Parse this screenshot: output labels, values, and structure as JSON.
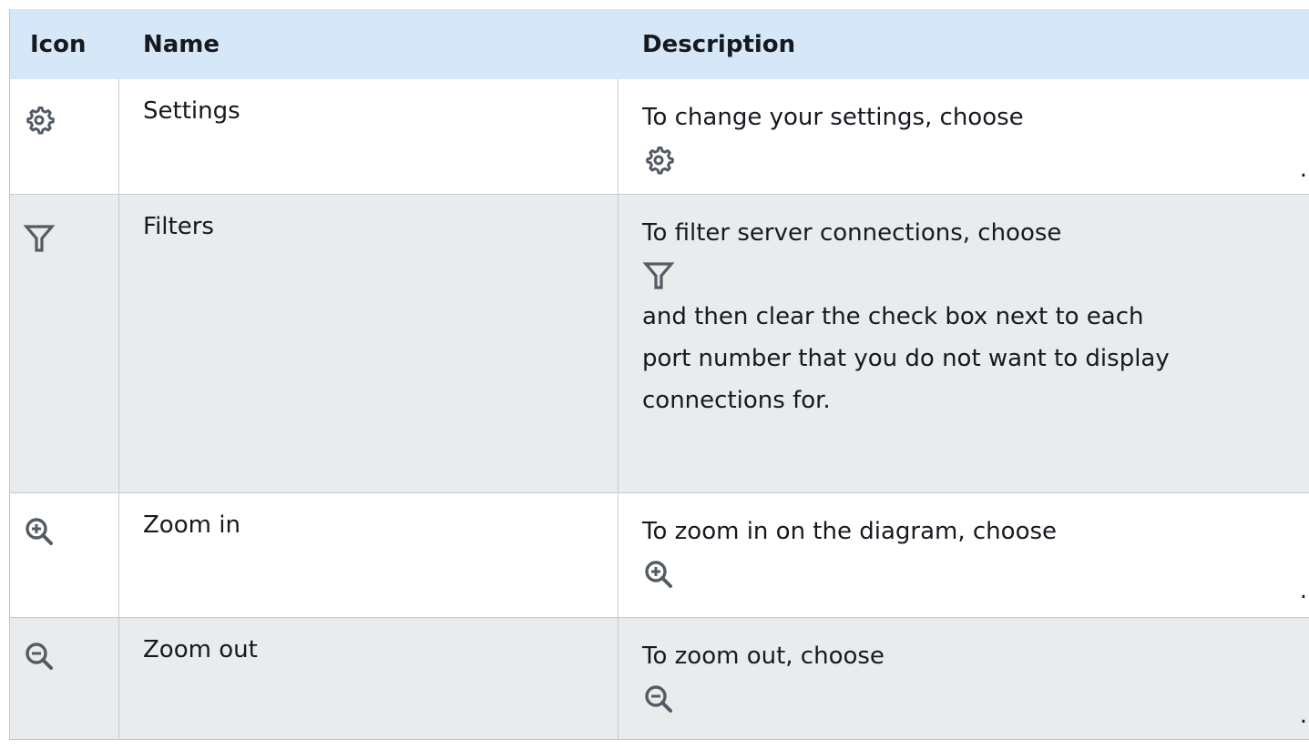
{
  "table": {
    "headers": {
      "icon": "Icon",
      "name": "Name",
      "description": "Description"
    },
    "rows": [
      {
        "icon": "gear-icon",
        "name": "Settings",
        "description_lines": [
          "To change your settings, choose"
        ],
        "trailing": "."
      },
      {
        "icon": "filter-funnel-icon",
        "name": "Filters",
        "description_lines": [
          "To filter server connections, choose"
        ],
        "after_icon_lines": [
          "and then clear the check box next to each",
          "port number that you do not want to display",
          "connections for."
        ]
      },
      {
        "icon": "zoom-in-icon",
        "name": "Zoom in",
        "description_lines": [
          "To zoom in on the diagram, choose"
        ],
        "trailing": "."
      },
      {
        "icon": "zoom-out-icon",
        "name": "Zoom out",
        "description_lines": [
          "To zoom out, choose"
        ],
        "trailing": "."
      }
    ]
  },
  "colors": {
    "header_bg": "#d6e7f7",
    "alt_row_bg": "#e9ebed",
    "icon_color": "#545b64",
    "text": "#16191f"
  }
}
